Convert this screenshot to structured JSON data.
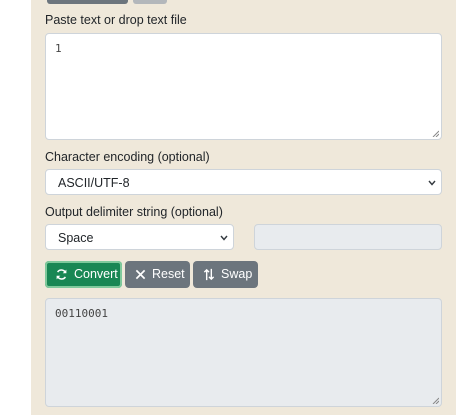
{
  "input_section": {
    "label": "Paste text or drop text file",
    "value": "1"
  },
  "encoding": {
    "label": "Character encoding (optional)",
    "selected": "ASCII/UTF-8"
  },
  "delimiter": {
    "label": "Output delimiter string (optional)",
    "selected": "Space",
    "custom_value": ""
  },
  "buttons": {
    "convert": "Convert",
    "reset": "Reset",
    "swap": "Swap"
  },
  "output_section": {
    "value": "00110001"
  },
  "colors": {
    "panel_background": "#efe8da",
    "convert_button": "#198754",
    "secondary_button": "#6c757d"
  },
  "icons": {
    "convert": "refresh-icon",
    "reset": "close-icon",
    "swap": "swap-vertical-icon"
  }
}
